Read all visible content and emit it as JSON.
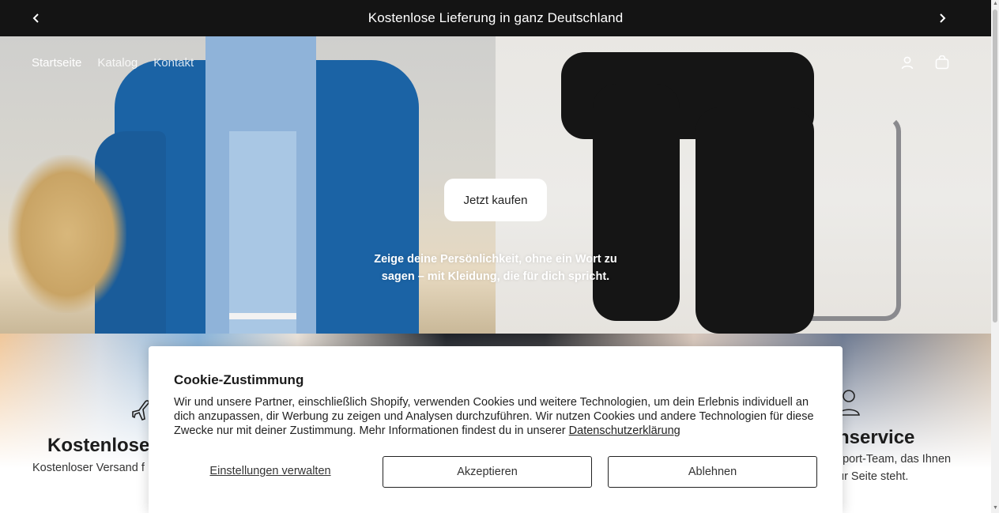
{
  "announcement": {
    "text": "Kostenlose Lieferung in ganz Deutschland",
    "prev_icon": "chevron-left-icon",
    "next_icon": "chevron-right-icon"
  },
  "nav": {
    "items": [
      {
        "label": "Startseite",
        "active": true
      },
      {
        "label": "Katalog",
        "active": false
      },
      {
        "label": "Kontakt",
        "active": false
      }
    ],
    "icons": [
      "account-icon",
      "cart-icon"
    ]
  },
  "hero": {
    "cta_label": "Jetzt kaufen",
    "tagline": "Zeige deine Persönlichkeit, ohne ein Wort zu sagen – mit Kleidung, die für dich spricht."
  },
  "features": {
    "left": {
      "icon": "airplane-icon",
      "title": "Kostenlose",
      "desc": "Kostenloser Versand f"
    },
    "right": {
      "icon": "person-icon",
      "title": "nservice",
      "desc_line1": "pport-Team, das Ihnen",
      "desc_line2": "ur Seite steht."
    }
  },
  "cookie": {
    "title": "Cookie-Zustimmung",
    "body": "Wir und unsere Partner, einschließlich Shopify, verwenden Cookies und weitere Technologien, um dein Erlebnis individuell an dich anzupassen, dir Werbung zu zeigen und Analysen durchzuführen. Wir nutzen Cookies und andere Technologien für diese Zwecke nur mit deiner Zustimmung. Mehr Informationen findest du in unserer",
    "privacy_link": "Datenschutzerklärung",
    "manage_label": "Einstellungen verwalten",
    "accept_label": "Akzeptieren",
    "decline_label": "Ablehnen"
  },
  "colors": {
    "announcement_bg": "#141414",
    "jacket_blue": "#1b63a5",
    "text_dark": "#1c1c1c"
  }
}
